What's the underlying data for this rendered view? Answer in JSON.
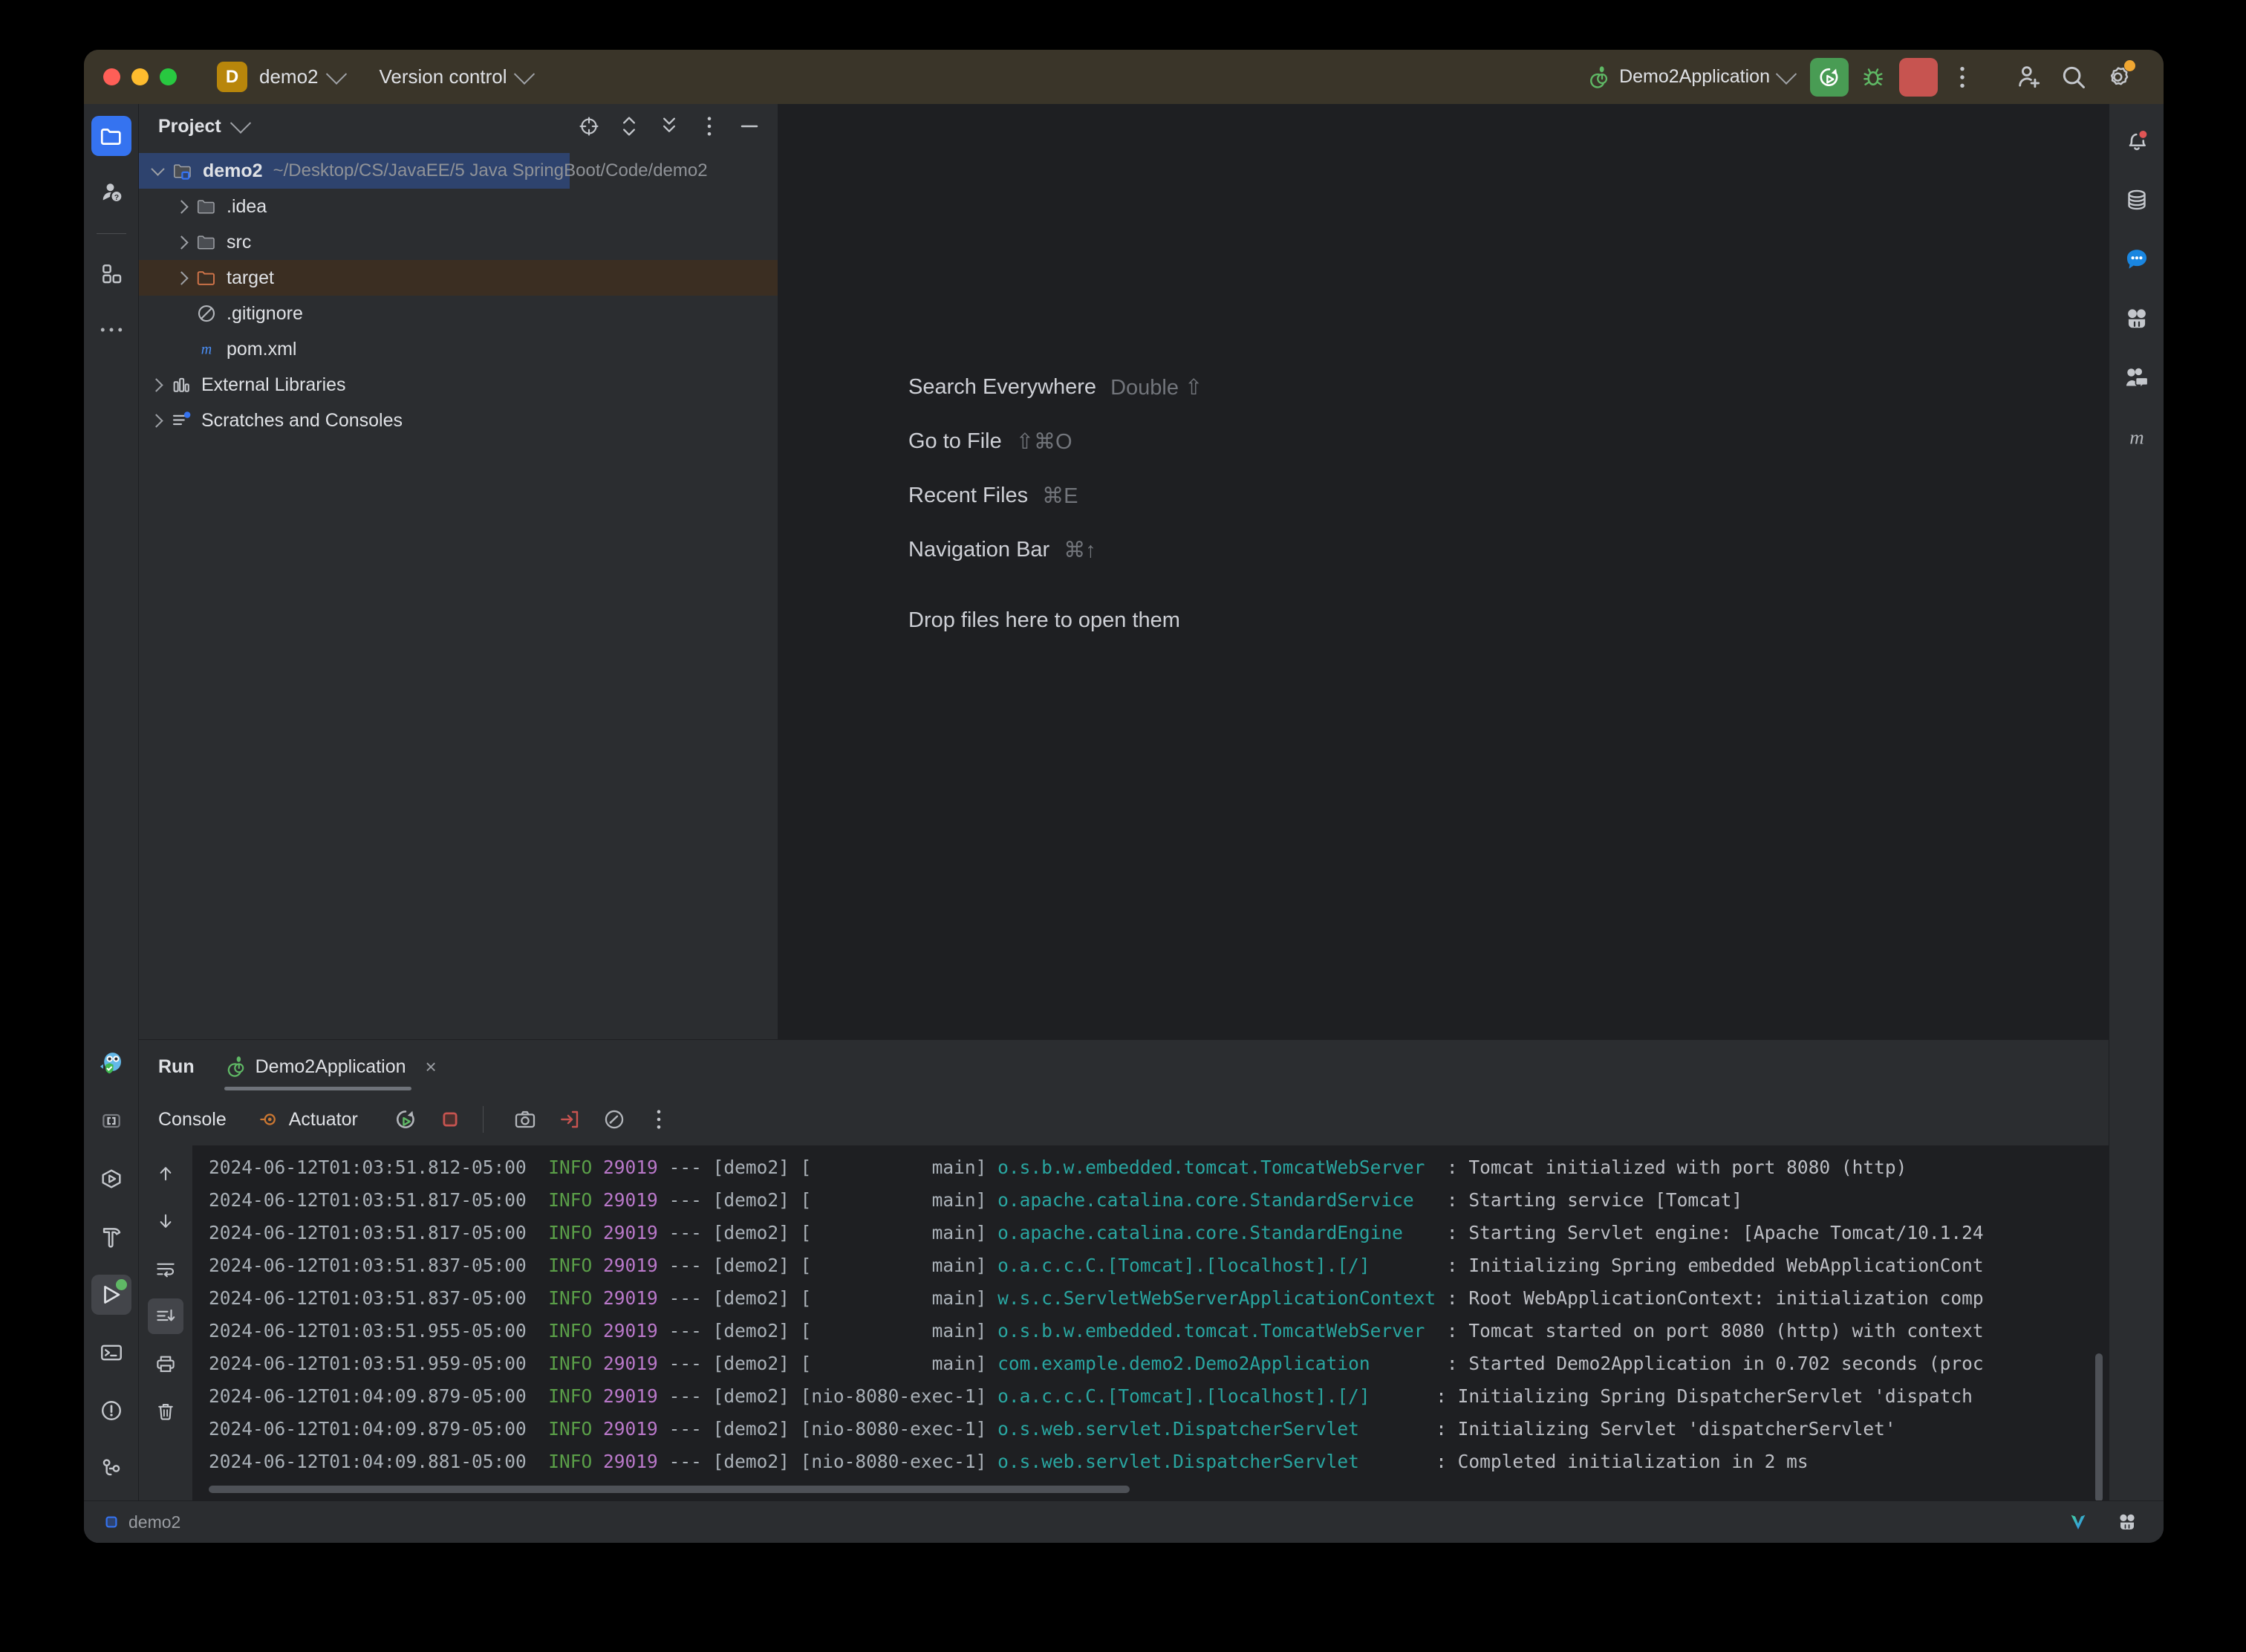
{
  "titlebar": {
    "project_badge": "D",
    "project_name": "demo2",
    "vcs_label": "Version control",
    "run_config": "Demo2Application",
    "buttons": {
      "run": "run-button",
      "debug": "debug-button",
      "stop": "stop-button",
      "more": "more-actions-button",
      "add_user": "add-user-button",
      "search": "search-button",
      "settings": "settings-button"
    }
  },
  "leftbar": {
    "items": [
      {
        "name": "project-tool-window",
        "icon": "folder-icon",
        "active": true
      },
      {
        "name": "learn-tool-window",
        "icon": "question-people-icon",
        "active": false
      },
      {
        "name": "plugins-tool-window",
        "icon": "grid-blocks-icon",
        "active": false
      },
      {
        "name": "more-tool-windows",
        "icon": "ellipsis-icon",
        "active": false
      }
    ],
    "bottom_items": [
      {
        "name": "ai-assistant-tool-window",
        "icon": "owl-shield-icon"
      },
      {
        "name": "bookmarks-tool-window",
        "icon": "brackets-icon"
      },
      {
        "name": "services-tool-window",
        "icon": "hexagon-play-icon"
      },
      {
        "name": "build-tool-window",
        "icon": "hammer-icon"
      },
      {
        "name": "run-tool-window",
        "icon": "play-green-dot-icon"
      },
      {
        "name": "terminal-tool-window",
        "icon": "terminal-icon"
      },
      {
        "name": "problems-tool-window",
        "icon": "warning-circle-icon"
      },
      {
        "name": "version-control-tool-window",
        "icon": "git-branch-icon"
      }
    ]
  },
  "project_panel": {
    "title": "Project",
    "tools": [
      {
        "name": "select-opened-file-icon",
        "icon": "crosshair-icon"
      },
      {
        "name": "expand-collapse-icon",
        "icon": "chevrons-updown-icon"
      },
      {
        "name": "collapse-all-icon",
        "icon": "collapse-all-icon"
      },
      {
        "name": "panel-options-icon",
        "icon": "vertical-ellipsis-icon"
      },
      {
        "name": "hide-panel-icon",
        "icon": "minus-icon"
      }
    ],
    "tree": [
      {
        "label": "demo2",
        "path": "~/Desktop/CS/JavaEE/5 Java SpringBoot/Code/demo2",
        "icon": "module-folder-icon",
        "depth": 0,
        "expanded": true,
        "selected": true,
        "bold": true
      },
      {
        "label": ".idea",
        "path": "",
        "icon": "folder-icon",
        "depth": 1,
        "expanded": false,
        "selected": false,
        "bold": false
      },
      {
        "label": "src",
        "path": "",
        "icon": "folder-icon",
        "depth": 1,
        "expanded": false,
        "selected": false,
        "bold": false
      },
      {
        "label": "target",
        "path": "",
        "icon": "folder-orange-icon",
        "depth": 1,
        "expanded": false,
        "selected": false,
        "bold": false,
        "highlight": true
      },
      {
        "label": ".gitignore",
        "path": "",
        "icon": "gitignore-icon",
        "depth": 1,
        "leaf": true,
        "bold": false
      },
      {
        "label": "pom.xml",
        "path": "",
        "icon": "maven-m-icon",
        "depth": 1,
        "leaf": true,
        "bold": false
      },
      {
        "label": "External Libraries",
        "path": "",
        "icon": "libraries-icon",
        "depth": 0,
        "expanded": false,
        "bold": false
      },
      {
        "label": "Scratches and Consoles",
        "path": "",
        "icon": "scratches-icon",
        "depth": 0,
        "expanded": false,
        "bold": false
      }
    ]
  },
  "editor": {
    "hints": [
      {
        "label": "Search Everywhere",
        "key": "Double ⇧"
      },
      {
        "label": "Go to File",
        "key": "⇧⌘O"
      },
      {
        "label": "Recent Files",
        "key": "⌘E"
      },
      {
        "label": "Navigation Bar",
        "key": "⌘↑"
      }
    ],
    "drop_hint": "Drop files here to open them"
  },
  "run_panel": {
    "title": "Run",
    "tab_label": "Demo2Application",
    "tab_close": "×",
    "console_label": "Console",
    "actuator_label": "Actuator",
    "toolbar": [
      {
        "name": "rerun-button",
        "icon": "rerun-icon"
      },
      {
        "name": "stop-button",
        "icon": "stop-square-icon"
      },
      {
        "name": "screenshot-button",
        "icon": "camera-icon"
      },
      {
        "name": "export-button",
        "icon": "export-arrow-icon"
      },
      {
        "name": "profiler-button",
        "icon": "gauge-icon"
      },
      {
        "name": "more-options-button",
        "icon": "vertical-ellipsis-icon"
      }
    ],
    "gutter": [
      {
        "name": "scroll-up-button",
        "icon": "arrow-up-icon"
      },
      {
        "name": "scroll-down-button",
        "icon": "arrow-down-icon"
      },
      {
        "name": "soft-wrap-button",
        "icon": "soft-wrap-icon"
      },
      {
        "name": "scroll-to-end-button",
        "icon": "scroll-to-end-icon",
        "selected": true
      },
      {
        "name": "print-button",
        "icon": "printer-icon"
      },
      {
        "name": "clear-all-button",
        "icon": "trash-icon"
      }
    ],
    "console_lines": [
      {
        "ts": "2024-06-12T01:03:51.812-05:00",
        "level": "INFO",
        "pid": "29019",
        "app": "[demo2]",
        "thread": "[           main]",
        "logger": "o.s.b.w.embedded.tomcat.TomcatWebServer  ",
        "msg": ": Tomcat initialized with port 8080 (http)"
      },
      {
        "ts": "2024-06-12T01:03:51.817-05:00",
        "level": "INFO",
        "pid": "29019",
        "app": "[demo2]",
        "thread": "[           main]",
        "logger": "o.apache.catalina.core.StandardService   ",
        "msg": ": Starting service [Tomcat]"
      },
      {
        "ts": "2024-06-12T01:03:51.817-05:00",
        "level": "INFO",
        "pid": "29019",
        "app": "[demo2]",
        "thread": "[           main]",
        "logger": "o.apache.catalina.core.StandardEngine    ",
        "msg": ": Starting Servlet engine: [Apache Tomcat/10.1.24"
      },
      {
        "ts": "2024-06-12T01:03:51.837-05:00",
        "level": "INFO",
        "pid": "29019",
        "app": "[demo2]",
        "thread": "[           main]",
        "logger": "o.a.c.c.C.[Tomcat].[localhost].[/]       ",
        "msg": ": Initializing Spring embedded WebApplicationCont"
      },
      {
        "ts": "2024-06-12T01:03:51.837-05:00",
        "level": "INFO",
        "pid": "29019",
        "app": "[demo2]",
        "thread": "[           main]",
        "logger": "w.s.c.ServletWebServerApplicationContext ",
        "msg": ": Root WebApplicationContext: initialization comp"
      },
      {
        "ts": "2024-06-12T01:03:51.955-05:00",
        "level": "INFO",
        "pid": "29019",
        "app": "[demo2]",
        "thread": "[           main]",
        "logger": "o.s.b.w.embedded.tomcat.TomcatWebServer  ",
        "msg": ": Tomcat started on port 8080 (http) with context"
      },
      {
        "ts": "2024-06-12T01:03:51.959-05:00",
        "level": "INFO",
        "pid": "29019",
        "app": "[demo2]",
        "thread": "[           main]",
        "logger": "com.example.demo2.Demo2Application       ",
        "msg": ": Started Demo2Application in 0.702 seconds (proc"
      },
      {
        "ts": "2024-06-12T01:04:09.879-05:00",
        "level": "INFO",
        "pid": "29019",
        "app": "[demo2]",
        "thread": "[nio-8080-exec-1]",
        "logger": "o.a.c.c.C.[Tomcat].[localhost].[/]      ",
        "msg": ": Initializing Spring DispatcherServlet 'dispatch"
      },
      {
        "ts": "2024-06-12T01:04:09.879-05:00",
        "level": "INFO",
        "pid": "29019",
        "app": "[demo2]",
        "thread": "[nio-8080-exec-1]",
        "logger": "o.s.web.servlet.DispatcherServlet       ",
        "msg": ": Initializing Servlet 'dispatcherServlet'"
      },
      {
        "ts": "2024-06-12T01:04:09.881-05:00",
        "level": "INFO",
        "pid": "29019",
        "app": "[demo2]",
        "thread": "[nio-8080-exec-1]",
        "logger": "o.s.web.servlet.DispatcherServlet       ",
        "msg": ": Completed initialization in 2 ms"
      }
    ]
  },
  "rightbar": {
    "items": [
      {
        "name": "notifications-tool-window",
        "icon": "bell-icon",
        "badge": "red"
      },
      {
        "name": "database-tool-window",
        "icon": "database-icon"
      },
      {
        "name": "ai-chat-tool-window",
        "icon": "chat-bubble-icon"
      },
      {
        "name": "junie-tool-window",
        "icon": "robot-face-icon"
      },
      {
        "name": "code-with-me-tool-window",
        "icon": "people-chat-icon"
      },
      {
        "name": "maven-tool-window",
        "icon": "maven-m-icon"
      }
    ]
  },
  "statusbar": {
    "project_label": "demo2",
    "right_items": [
      {
        "name": "vite-status-icon",
        "icon": "v-logo-icon"
      },
      {
        "name": "junie-status-icon",
        "icon": "robot-face-icon"
      }
    ]
  },
  "colors": {
    "accent_blue": "#3573f0",
    "run_green": "#499c54",
    "stop_red": "#c75450",
    "panel_bg": "#2b2d30",
    "editor_bg": "#1e1f22",
    "selection_blue": "#2e436e",
    "target_highlight": "#3b2e22",
    "logger_teal": "#29a5a0",
    "info_green": "#5a9e48",
    "pid_purple": "#b978c9"
  }
}
